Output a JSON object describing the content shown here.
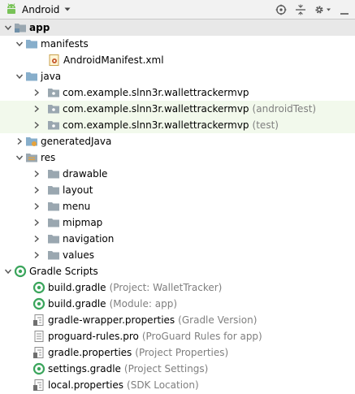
{
  "toolbar": {
    "view_label": "Android"
  },
  "tree": {
    "app": {
      "label": "app"
    },
    "manifests": {
      "label": "manifests"
    },
    "manifest_file": {
      "label": "AndroidManifest.xml"
    },
    "java": {
      "label": "java"
    },
    "pkg_main": {
      "label": "com.example.slnn3r.wallettrackermvp",
      "secondary": ""
    },
    "pkg_android_test": {
      "label": "com.example.slnn3r.wallettrackermvp",
      "secondary": "(androidTest)"
    },
    "pkg_test": {
      "label": "com.example.slnn3r.wallettrackermvp",
      "secondary": "(test)"
    },
    "generated_java": {
      "label": "generatedJava"
    },
    "res": {
      "label": "res"
    },
    "drawable": {
      "label": "drawable"
    },
    "layout": {
      "label": "layout"
    },
    "menu": {
      "label": "menu"
    },
    "mipmap": {
      "label": "mipmap"
    },
    "navigation": {
      "label": "navigation"
    },
    "values": {
      "label": "values"
    },
    "gradle_scripts": {
      "label": "Gradle Scripts"
    },
    "build_gradle_project": {
      "label": "build.gradle",
      "secondary": "(Project: WalletTracker)"
    },
    "build_gradle_module": {
      "label": "build.gradle",
      "secondary": "(Module: app)"
    },
    "gradle_wrapper": {
      "label": "gradle-wrapper.properties",
      "secondary": "(Gradle Version)"
    },
    "proguard": {
      "label": "proguard-rules.pro",
      "secondary": "(ProGuard Rules for app)"
    },
    "gradle_properties": {
      "label": "gradle.properties",
      "secondary": "(Project Properties)"
    },
    "settings_gradle": {
      "label": "settings.gradle",
      "secondary": "(Project Settings)"
    },
    "local_properties": {
      "label": "local.properties",
      "secondary": "(SDK Location)"
    }
  },
  "colors": {
    "highlight_row": "#f2f9ec",
    "selected_row": "#e8e8e8",
    "folder_blue": "#87aecb",
    "gradle_green": "#3ba55c",
    "android_green": "#78c257",
    "secondary_text": "#7f7f7f"
  }
}
